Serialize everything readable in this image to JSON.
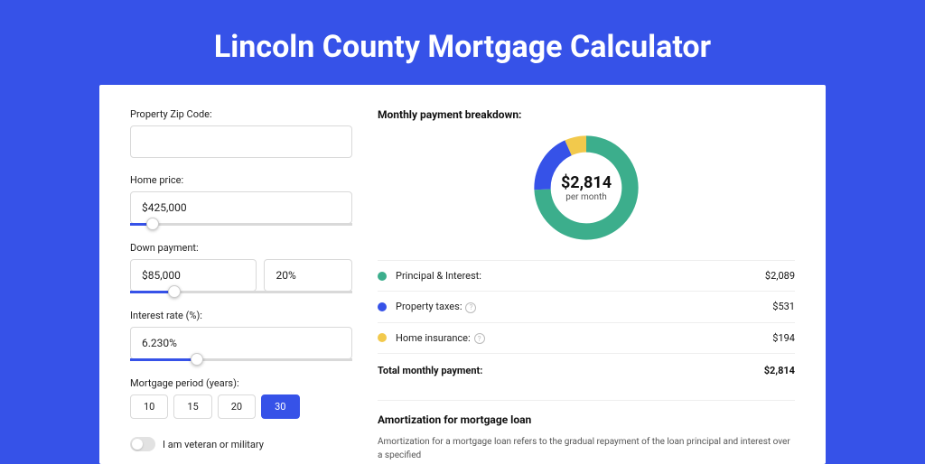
{
  "title": "Lincoln County Mortgage Calculator",
  "form": {
    "zip_label": "Property Zip Code:",
    "zip_value": "",
    "home_price_label": "Home price:",
    "home_price_value": "$425,000",
    "home_price_pct": 10,
    "down_label": "Down payment:",
    "down_value": "$85,000",
    "down_pct_value": "20%",
    "down_slider_pct": 20,
    "rate_label": "Interest rate (%):",
    "rate_value": "6.230%",
    "rate_slider_pct": 30,
    "period_label": "Mortgage period (years):",
    "periods": [
      "10",
      "15",
      "20",
      "30"
    ],
    "period_active": 3,
    "veteran_label": "I am veteran or military"
  },
  "breakdown": {
    "title": "Monthly payment breakdown:",
    "amount": "$2,814",
    "sub": "per month",
    "rows": [
      {
        "label": "Principal & Interest:",
        "value": "$2,089",
        "color": "#3cae8c",
        "info": false
      },
      {
        "label": "Property taxes:",
        "value": "$531",
        "color": "#3652e8",
        "info": true
      },
      {
        "label": "Home insurance:",
        "value": "$194",
        "color": "#f2c94c",
        "info": true
      }
    ],
    "total_label": "Total monthly payment:",
    "total_value": "$2,814"
  },
  "amort": {
    "title": "Amortization for mortgage loan",
    "body": "Amortization for a mortgage loan refers to the gradual repayment of the loan principal and interest over a specified"
  },
  "chart_data": {
    "type": "pie",
    "title": "Monthly payment breakdown",
    "series": [
      {
        "name": "Principal & Interest",
        "value": 2089,
        "color": "#3cae8c"
      },
      {
        "name": "Property taxes",
        "value": 531,
        "color": "#3652e8"
      },
      {
        "name": "Home insurance",
        "value": 194,
        "color": "#f2c94c"
      }
    ],
    "total": 2814
  }
}
